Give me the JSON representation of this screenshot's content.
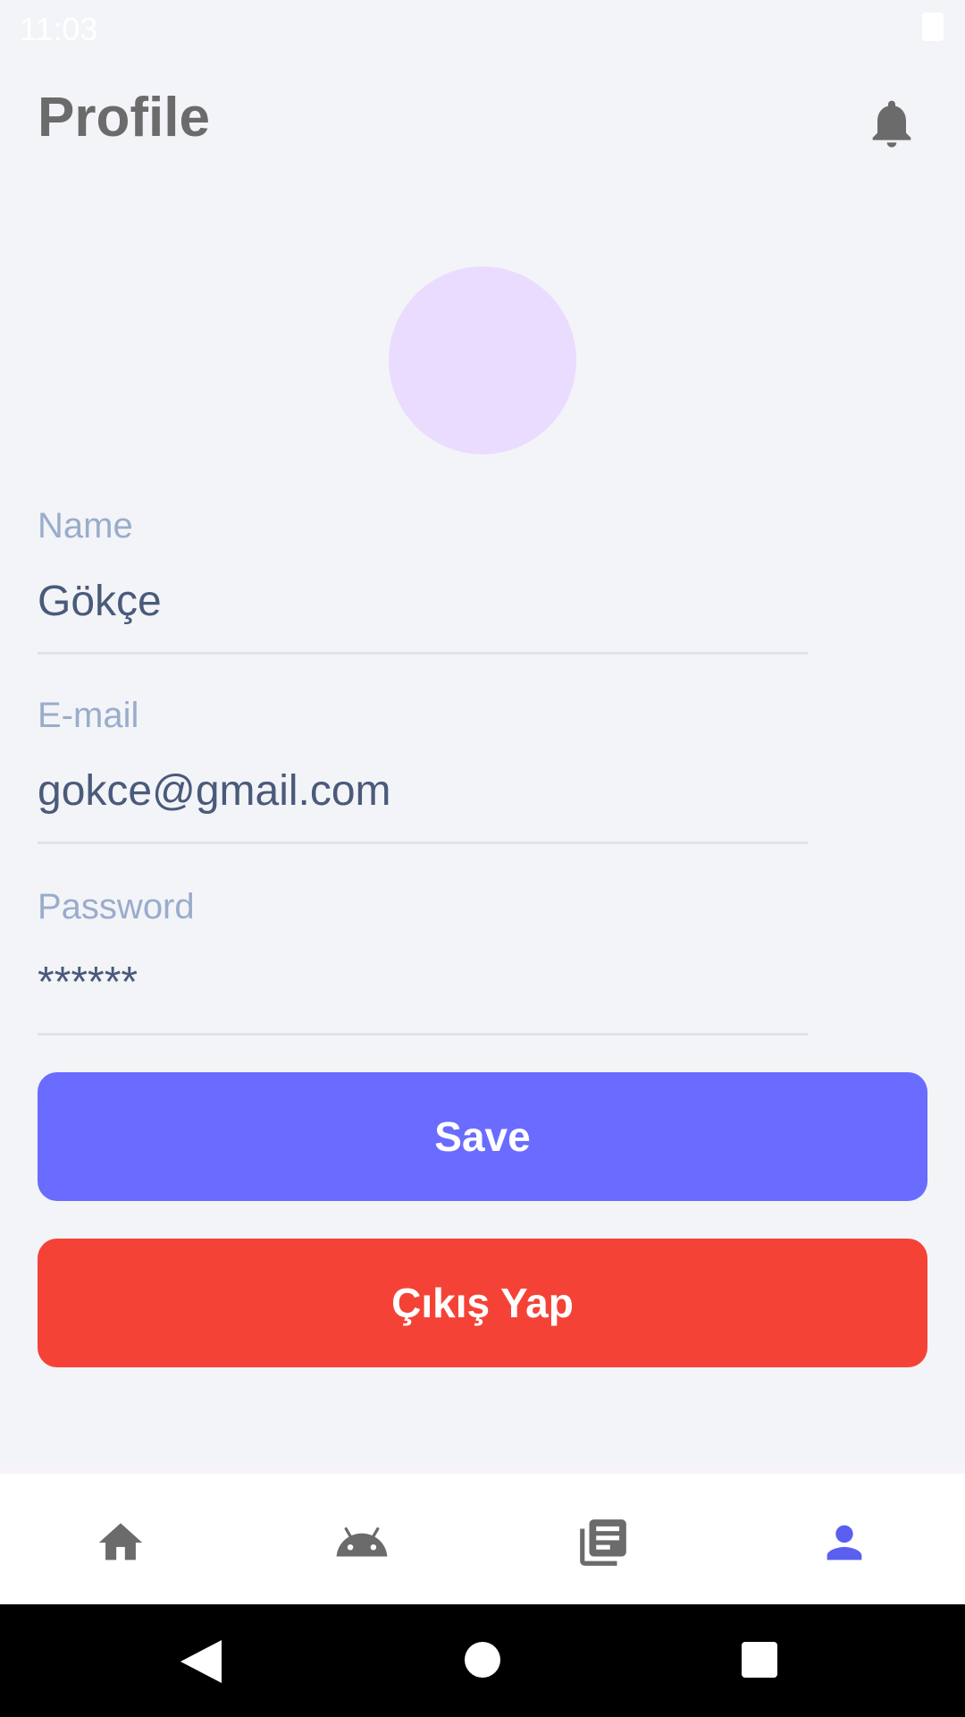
{
  "status_bar": {
    "time": "11:03",
    "battery_icon": "battery-icon"
  },
  "header": {
    "title": "Profile",
    "notification_icon": "bell-icon"
  },
  "avatar": {
    "color": "#eadcff"
  },
  "fields": {
    "name": {
      "label": "Name",
      "value": "Gökçe"
    },
    "email": {
      "label": "E-mail",
      "value": "gokce@gmail.com"
    },
    "password": {
      "label": "Password",
      "value": "******"
    }
  },
  "buttons": {
    "save": {
      "label": "Save",
      "color": "#6a6cff"
    },
    "logout": {
      "label": "Çıkış Yap",
      "color": "#f44336"
    }
  },
  "bottom_nav": {
    "items": [
      {
        "icon": "home-icon",
        "active": false
      },
      {
        "icon": "android-icon",
        "active": false
      },
      {
        "icon": "news-icon",
        "active": false
      },
      {
        "icon": "person-icon",
        "active": true
      }
    ],
    "active_color": "#5b5ff0",
    "inactive_color": "#6b6b6b"
  },
  "system_nav": {
    "icons": [
      "back-icon",
      "home-circle-icon",
      "recents-icon"
    ]
  }
}
